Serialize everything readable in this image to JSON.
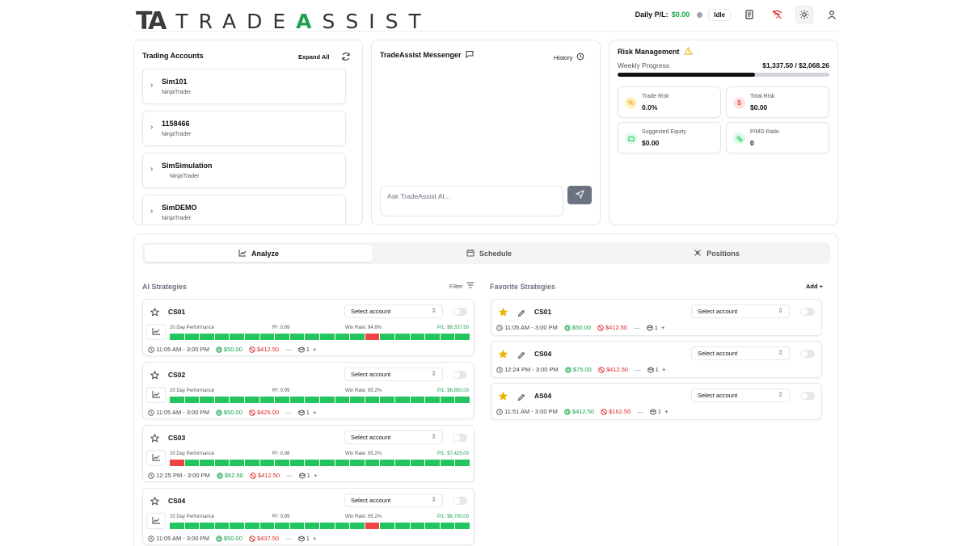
{
  "brand": {
    "mark": "TA",
    "name_prefix": "TRADE",
    "name_a": "A",
    "name_suffix": "SSIST"
  },
  "header": {
    "pl_label": "Daily P/L:",
    "pl_value": "$0.00",
    "status": "Idle"
  },
  "accounts": {
    "title": "Trading Accounts",
    "expand_label": "Expand All",
    "items": [
      {
        "name": "Sim101",
        "broker": "NinjaTrader"
      },
      {
        "name": "1158466",
        "broker": "NinjaTrader"
      },
      {
        "name": "SimSimulation",
        "broker": "NinjaTrader"
      },
      {
        "name": "SimDEMO",
        "broker": "NinjaTrader"
      }
    ]
  },
  "messenger": {
    "title": "TradeAssist Messenger",
    "history_label": "History",
    "input_placeholder": "Ask TradeAssist AI..."
  },
  "risk": {
    "title": "Risk Management",
    "weekly_label": "Weekly Progress",
    "weekly_value": "$1,337.50 / $2,068.26",
    "weekly_progress": 0.647,
    "tiles": [
      {
        "label": "Trade Risk",
        "value": "0.0%",
        "icon": "percent-icon",
        "color": "#f59e0b"
      },
      {
        "label": "Total Risk",
        "value": "$0.00",
        "icon": "dollar-icon",
        "color": "#ef4444"
      },
      {
        "label": "Suggested Equity",
        "value": "$0.00",
        "icon": "wallet-icon",
        "color": "#22c55e"
      },
      {
        "label": "P/MD Ratio",
        "value": "0",
        "icon": "ratio-icon",
        "color": "#22c55e"
      }
    ]
  },
  "tabs": [
    {
      "label": "Analyze",
      "icon": "chart-line-icon"
    },
    {
      "label": "Schedule",
      "icon": "calendar-icon"
    },
    {
      "label": "Positions",
      "icon": "crosshair-icon"
    }
  ],
  "ai": {
    "title": "AI Strategies",
    "filter_label": "Filter",
    "perf_label": "20 Day Performance",
    "select_label": "Select account",
    "strategies": [
      {
        "name": "CS01",
        "r2": "R²: 0.99",
        "winrate": "Win Rate: 94.8%",
        "pl": "P/L: $8,337.50",
        "bars": "gggggggggggggrgggggg",
        "time": "11:05 AM - 3:00 PM",
        "profit": "$50.00",
        "loss": "$412.50",
        "qty": "1"
      },
      {
        "name": "CS02",
        "r2": "R²: 0.99",
        "winrate": "Win Rate: 95.2%",
        "pl": "P/L: $6,850.00",
        "bars": "gggggggggggggggggggg",
        "time": "11:05 AM - 3:00 PM",
        "profit": "$50.00",
        "loss": "$425.00",
        "qty": "1"
      },
      {
        "name": "CS03",
        "r2": "R²: 0.98",
        "winrate": "Win Rate: 95.2%",
        "pl": "P/L: $7,425.00",
        "bars": "rggggggggggggggggggg",
        "time": "12:25 PM - 3:00 PM",
        "profit": "$62.50",
        "loss": "$412.50",
        "qty": "1"
      },
      {
        "name": "CS04",
        "r2": "R²: 0.99",
        "winrate": "Win Rate: 95.2%",
        "pl": "P/L: $6,700.00",
        "bars": "gggggggggggggrgggggg",
        "time": "11:05 AM - 3:00 PM",
        "profit": "$50.00",
        "loss": "$437.50",
        "qty": "1"
      }
    ]
  },
  "fav": {
    "title": "Favorite Strategies",
    "add_label": "Add +",
    "select_label": "Select account",
    "strategies": [
      {
        "name": "CS01",
        "time": "11:05 AM - 3:00 PM",
        "profit": "$50.00",
        "loss": "$412.50",
        "qty": "1"
      },
      {
        "name": "CS04",
        "time": "12:24 PM - 3:00 PM",
        "profit": "$75.00",
        "loss": "$412.50",
        "qty": "1"
      },
      {
        "name": "AS04",
        "time": "11:51 AM - 3:00 PM",
        "profit": "$412.50",
        "loss": "$162.50",
        "qty": "1"
      }
    ]
  }
}
